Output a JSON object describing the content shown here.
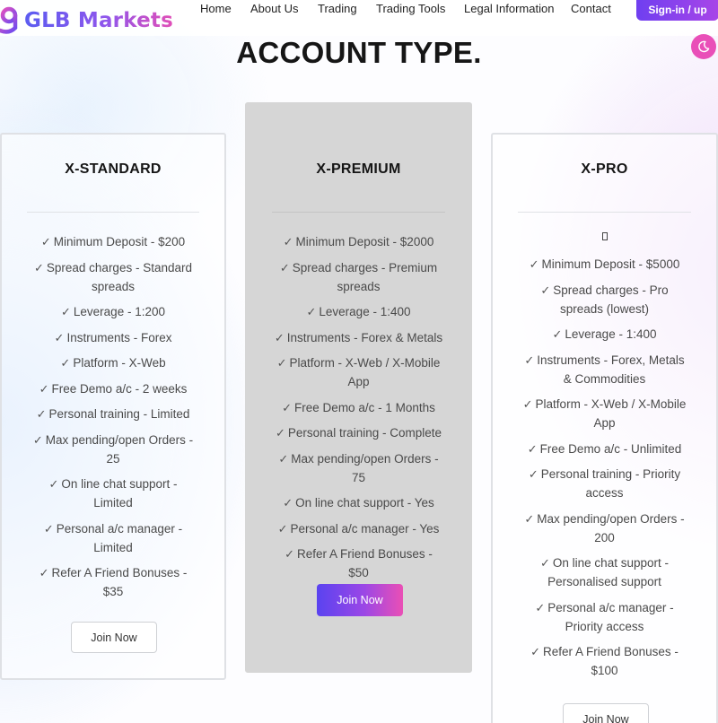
{
  "brand": {
    "name": "GLB Markets"
  },
  "nav": {
    "links": [
      "Home",
      "About Us",
      "Trading",
      "Trading Tools",
      "Legal Information",
      "Contact"
    ],
    "signin_label": "Sign-in / up"
  },
  "page": {
    "title": "ACCOUNT TYPE."
  },
  "plans": [
    {
      "name": "X-STANDARD",
      "features": [
        "Minimum Deposit - $200",
        "Spread charges - Standard spreads",
        "Leverage - 1:200",
        "Instruments - Forex",
        "Platform - X-Web",
        "Free Demo a/c - 2 weeks",
        "Personal training - Limited",
        "Max pending/open Orders - 25",
        "On line chat support - Limited",
        "Personal a/c manager - Limited",
        "Refer A Friend Bonuses - $35"
      ],
      "button": "Join Now"
    },
    {
      "name": "X-PREMIUM",
      "features": [
        "Minimum Deposit - $2000",
        "Spread charges - Premium spreads",
        "Leverage - 1:400",
        "Instruments - Forex & Metals",
        "Platform - X-Web / X-Mobile App",
        "Free Demo a/c - 1 Months",
        "Personal training - Complete",
        "Max pending/open Orders - 75",
        "On line chat support - Yes",
        "Personal a/c manager - Yes",
        "Refer A Friend Bonuses - $50"
      ],
      "button": "Join Now"
    },
    {
      "name": "X-PRO",
      "features": [
        "Minimum Deposit - $5000",
        "Spread charges - Pro spreads (lowest)",
        "Leverage - 1:400",
        "Instruments - Forex, Metals & Commodities",
        "Platform - X-Web / X-Mobile App",
        "Free Demo a/c - Unlimited",
        "Personal training - Priority access",
        "Max pending/open Orders - 200",
        "On line chat support - Personalised support",
        "Personal a/c manager - Priority access",
        "Refer A Friend Bonuses - $100"
      ],
      "button": "Join Now"
    }
  ],
  "colors": {
    "accent_purple": "#6f3ff0",
    "accent_pink": "#ea4fb5",
    "featured_card_bg": "#d6d6d6",
    "theme_toggle": "#e94fb8"
  },
  "icons": {
    "check": "check-icon",
    "theme_toggle": "moon-icon",
    "logo": "glb-logo-icon"
  }
}
